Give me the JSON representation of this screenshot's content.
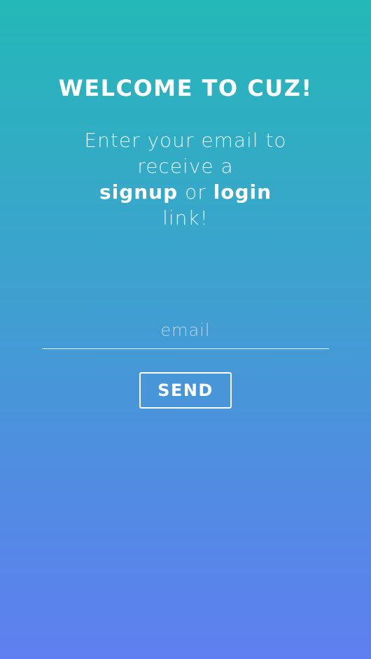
{
  "header": {
    "title": "WELCOME TO CUZ!"
  },
  "intro": {
    "line1": "Enter your email to",
    "line2": "receive a",
    "signup": "signup",
    "or": "or",
    "login": "login",
    "line4": "link!"
  },
  "form": {
    "email_placeholder": "email",
    "email_value": "",
    "send_label": "SEND"
  },
  "colors": {
    "gradient_top": "#24b8b8",
    "gradient_bottom": "#5f7ff0",
    "text": "#ffffff"
  }
}
